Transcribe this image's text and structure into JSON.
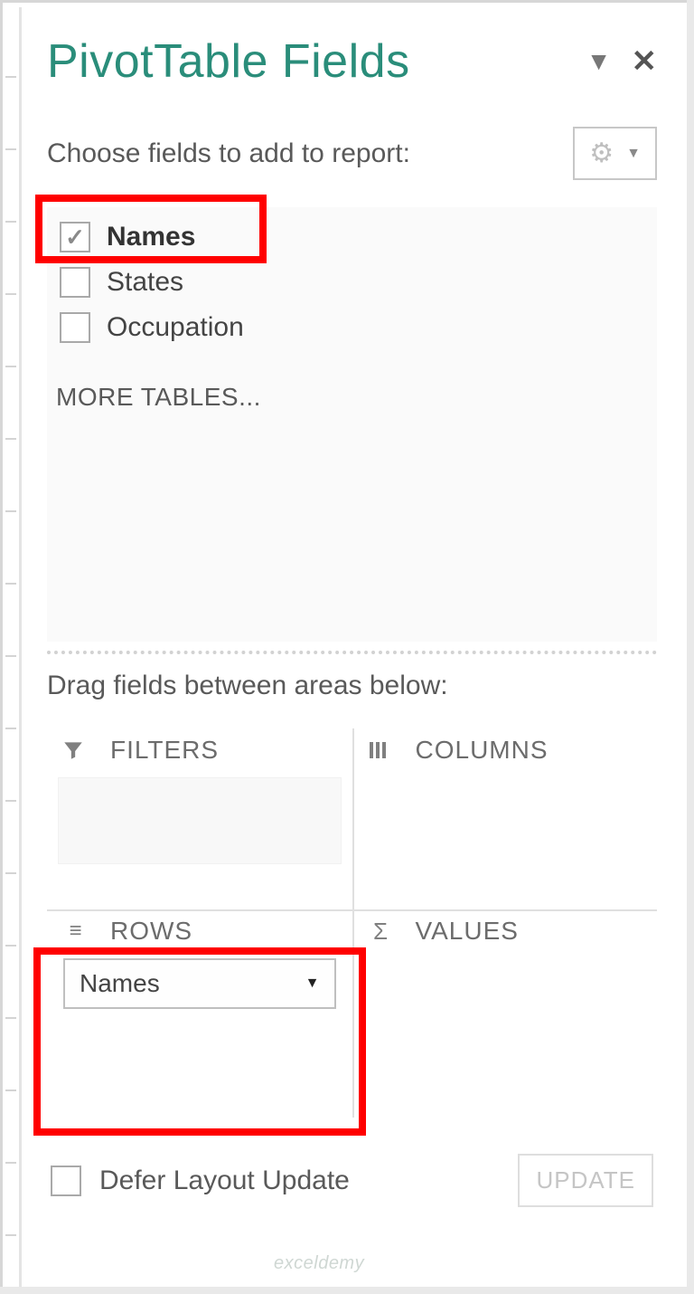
{
  "header": {
    "title": "PivotTable Fields"
  },
  "subheader": "Choose fields to add to report:",
  "fields": [
    {
      "label": "Names",
      "checked": true,
      "bold": true
    },
    {
      "label": "States",
      "checked": false,
      "bold": false
    },
    {
      "label": "Occupation",
      "checked": false,
      "bold": false
    }
  ],
  "more_tables": "MORE TABLES...",
  "drag_label": "Drag fields between areas below:",
  "areas": {
    "filters": {
      "title": "FILTERS",
      "items": []
    },
    "columns": {
      "title": "COLUMNS",
      "items": []
    },
    "rows": {
      "title": "ROWS",
      "items": [
        "Names"
      ]
    },
    "values": {
      "title": "VALUES",
      "items": []
    }
  },
  "footer": {
    "defer_label": "Defer Layout Update",
    "update_label": "UPDATE"
  },
  "watermark": "exceldemy"
}
